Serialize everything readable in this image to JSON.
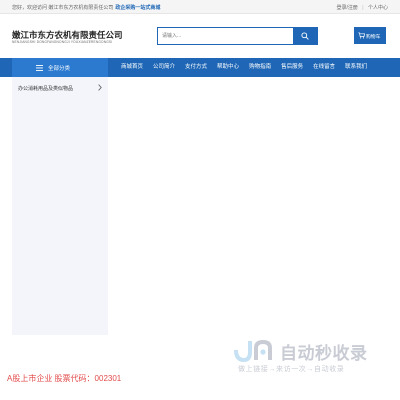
{
  "topbar": {
    "greeting": "您好，欢迎访问 嫩江市东方农机有限责任公司",
    "highlight": "政企采购一站式商城",
    "links": [
      "登录/注册",
      "|",
      "个人中心"
    ]
  },
  "header": {
    "company_name": "嫩江市东方农机有限责任公司",
    "company_name_en": "NENJIANGSHI DONGFANGNONGJI YOUXIANZERENGONGSI",
    "search_placeholder": "请输入...",
    "cart_label": "购物车"
  },
  "nav": {
    "all_categories": "全部分类",
    "items": [
      "商城首页",
      "公司简介",
      "支付方式",
      "帮助中心",
      "购物指南",
      "售后服务",
      "在线留言",
      "联系我们"
    ]
  },
  "sidebar": {
    "items": [
      {
        "label": "办公消耗用品及类似物品"
      }
    ]
  },
  "notice": "A股上市企业 股票代码：002301",
  "watermark": {
    "brand": "自动秒收录",
    "slogan": "做上链接→来访一次→自动收录"
  },
  "colors": {
    "brand_blue": "#1f67b6",
    "notice_red": "#e24b4b"
  }
}
